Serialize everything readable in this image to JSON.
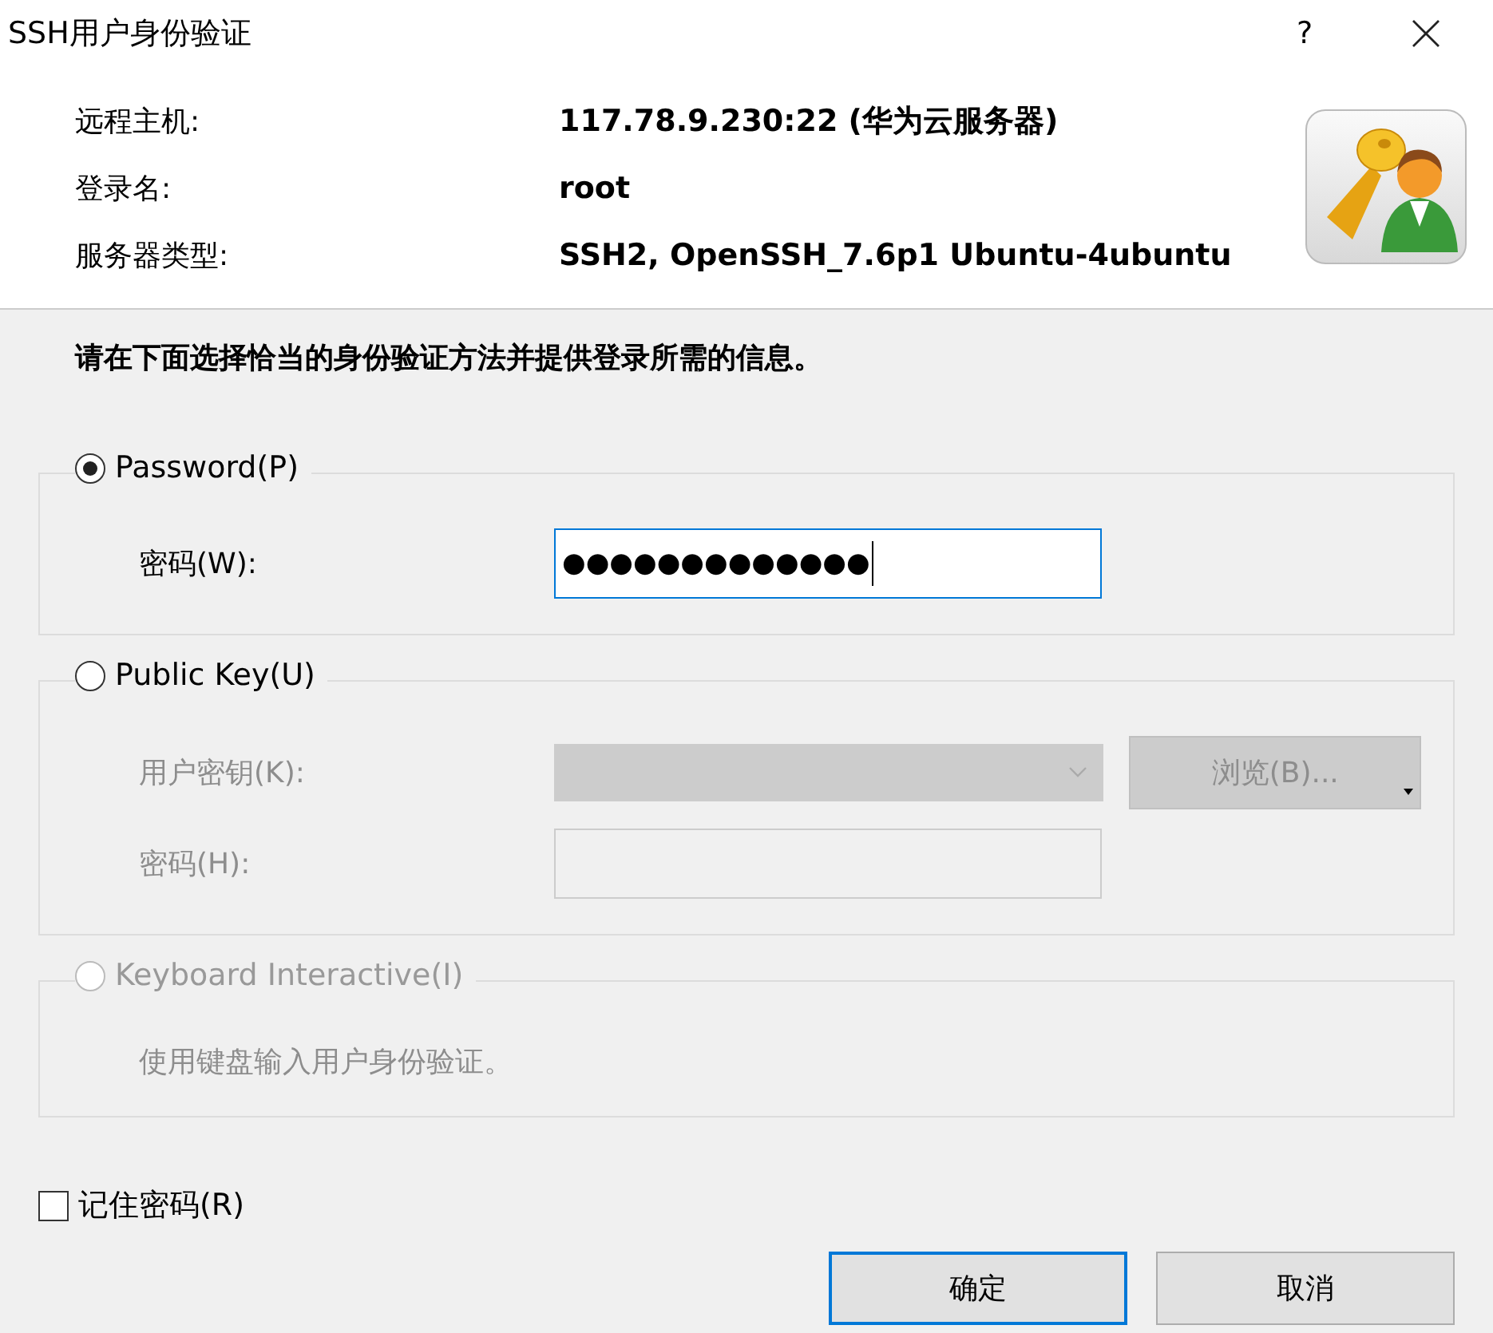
{
  "window": {
    "title": "SSH用户身份验证",
    "help": "?"
  },
  "info": [
    {
      "label": "远程主机:",
      "value": "117.78.9.230:22 (华为云服务器)"
    },
    {
      "label": "登录名:",
      "value": "root"
    },
    {
      "label": "服务器类型:",
      "value": "SSH2, OpenSSH_7.6p1 Ubuntu-4ubuntu"
    }
  ],
  "instruction": "请在下面选择恰当的身份验证方法并提供登录所需的信息。",
  "methods": [
    {
      "label": "Password(P)",
      "selected": true,
      "disabled": false,
      "rows": [
        {
          "kind": "password",
          "label": "密码(W):",
          "value": "●●●●●●●●●●●●●",
          "focused": true,
          "disabled": false
        }
      ]
    },
    {
      "label": "Public Key(U)",
      "selected": false,
      "disabled": false,
      "rows": [
        {
          "kind": "dropdown",
          "label": "用户密钥(K):",
          "disabled": true,
          "button": "浏览(B)..."
        },
        {
          "kind": "password",
          "label": "密码(H):",
          "value": "",
          "focused": false,
          "disabled": true
        }
      ]
    },
    {
      "label": "Keyboard Interactive(I)",
      "selected": false,
      "disabled": true,
      "rows": [
        {
          "kind": "note",
          "text": "使用键盘输入用户身份验证。",
          "disabled": true
        }
      ]
    }
  ],
  "remember": {
    "label": "记住密码(R)",
    "checked": false
  },
  "buttons": [
    {
      "label": "确定",
      "default": true
    },
    {
      "label": "取消",
      "default": false
    }
  ]
}
